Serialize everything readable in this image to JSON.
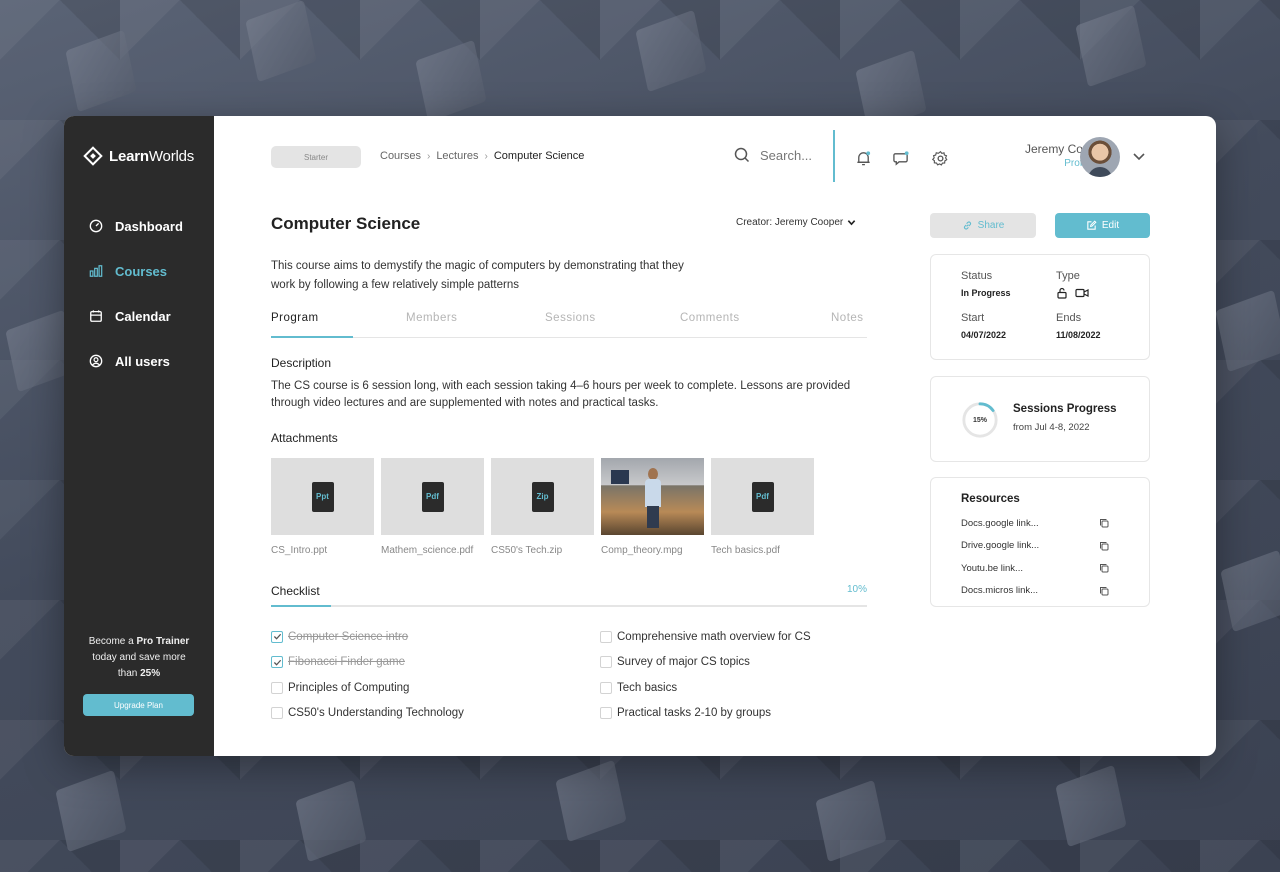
{
  "brand": {
    "logo_bold": "Learn",
    "logo_light": "Worlds"
  },
  "sidebar": {
    "items": [
      {
        "label": "Dashboard",
        "icon": "dashboard-icon",
        "active": false
      },
      {
        "label": "Courses",
        "icon": "bar-chart-icon",
        "active": true
      },
      {
        "label": "Calendar",
        "icon": "calendar-icon",
        "active": false
      },
      {
        "label": "All users",
        "icon": "user-circle-icon",
        "active": false
      }
    ],
    "promo_line1": "Become a ",
    "promo_bold": "Pro Trainer",
    "promo_line2": "today and save more",
    "promo_line3": "than ",
    "promo_percent": "25%",
    "upgrade_label": "Upgrade Plan"
  },
  "header": {
    "plan": "Starter",
    "breadcrumb": [
      "Courses",
      "Lectures",
      "Computer Science"
    ],
    "search_placeholder": "Search...",
    "user_name": "Jeremy Cooper",
    "user_role": "Professor"
  },
  "course": {
    "title": "Computer Science",
    "creator": "Creator: Jeremy Cooper",
    "summary": "This course aims to demystify the magic of computers by demonstrating that they work by following a few relatively simple patterns",
    "tabs": [
      "Program",
      "Members",
      "Sessions",
      "Comments",
      "Notes"
    ],
    "description_label": "Description",
    "description": "The CS course is 6 session long, with each session taking  4–6 hours per week  to complete. Lessons are provided through video lectures and are supplemented with notes and practical tasks.",
    "attachments_label": "Attachments",
    "attachments": [
      {
        "name": "CS_Intro.ppt",
        "badge": "Ppt"
      },
      {
        "name": "Mathem_science.pdf",
        "badge": "Pdf"
      },
      {
        "name": "CS50's Tech.zip",
        "badge": "Zip"
      },
      {
        "name": "Comp_theory.mpg",
        "badge": ""
      },
      {
        "name": "Tech basics.pdf",
        "badge": "Pdf"
      }
    ],
    "checklist_label": "Checklist",
    "checklist_percent": "10%",
    "checklist_left": [
      {
        "label": "Computer Science intro",
        "done": true
      },
      {
        "label": "Fibonacci Finder game",
        "done": true
      },
      {
        "label": "Principles of Computing",
        "done": false
      },
      {
        "label": "CS50's Understanding Technology",
        "done": false
      }
    ],
    "checklist_right": [
      {
        "label": "Comprehensive math overview for CS",
        "done": false
      },
      {
        "label": "Survey of major CS topics",
        "done": false
      },
      {
        "label": "Tech basics",
        "done": false
      },
      {
        "label": "Practical tasks 2-10 by groups",
        "done": false
      }
    ]
  },
  "actions": {
    "share": "Share",
    "edit": "Edit"
  },
  "info": {
    "status_label": "Status",
    "status_value": "In Progress",
    "type_label": "Type",
    "start_label": "Start",
    "start_value": "04/07/2022",
    "ends_label": "Ends",
    "ends_value": "11/08/2022"
  },
  "progress": {
    "percent_label": "15%",
    "fraction": 0.15,
    "title": "Sessions Progress",
    "subtitle": "from Jul 4-8, 2022"
  },
  "resources": {
    "title": "Resources",
    "items": [
      "Docs.google link...",
      "Drive.google link...",
      "Youtu.be link...",
      "Docs.micros link..."
    ]
  },
  "colors": {
    "accent": "#62bccf",
    "sidebar": "#2b2b2b"
  }
}
